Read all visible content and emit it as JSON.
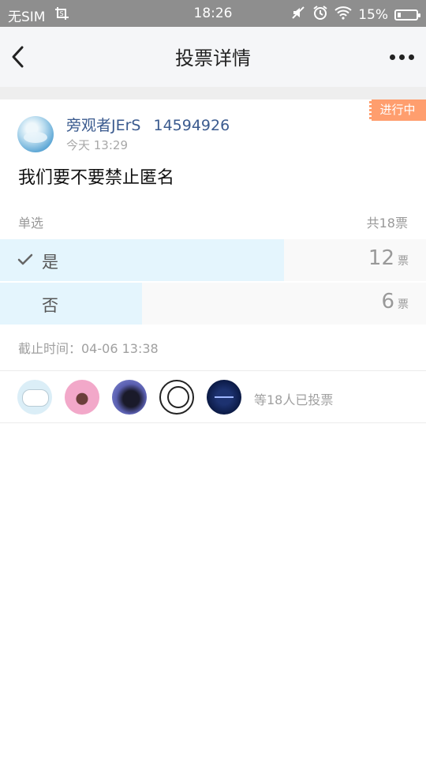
{
  "status_bar": {
    "carrier": "无SIM",
    "time": "18:26",
    "battery": "15%"
  },
  "header": {
    "title": "投票详情"
  },
  "poll": {
    "status_badge": "进行中",
    "author_name": "旁观者JErS",
    "author_id": "14594926",
    "post_time": "今天 13:29",
    "question": "我们要不要禁止匿名",
    "vote_type": "单选",
    "total_votes": "共18票",
    "options": [
      {
        "label": "是",
        "count": "12",
        "unit": "票",
        "fraction": 0.667,
        "selected": true
      },
      {
        "label": "否",
        "count": "6",
        "unit": "票",
        "fraction": 0.333,
        "selected": false
      }
    ],
    "deadline": "截止时间：04-06 13:38"
  },
  "voters": {
    "summary": "等18人已投票"
  },
  "colors": {
    "badge": "#ff9e6e",
    "bar": "#e4f5fd",
    "author": "#3b5b8f"
  }
}
